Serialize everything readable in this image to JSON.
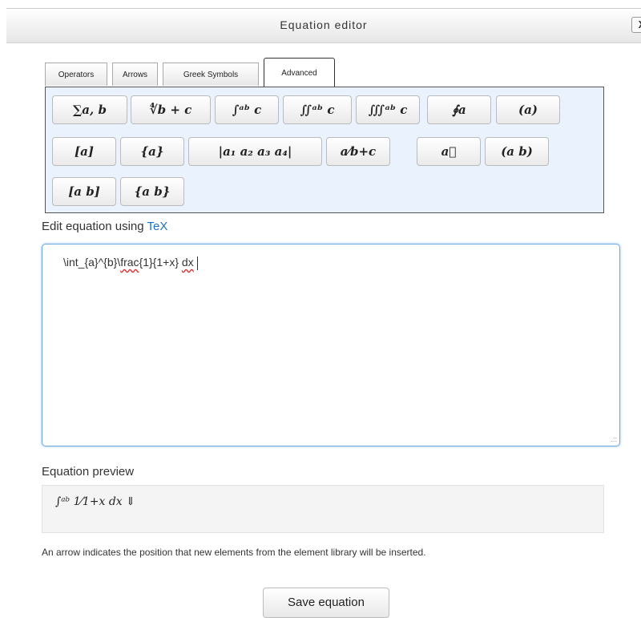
{
  "dialog": {
    "title": "Equation editor",
    "close_label": "X"
  },
  "tabs": [
    {
      "label": "Operators",
      "active": false
    },
    {
      "label": "Arrows",
      "active": false
    },
    {
      "label": "Greek Symbols",
      "active": false
    },
    {
      "label": "Advanced",
      "active": true
    }
  ],
  "library": {
    "buttons": [
      "∑a, b",
      "∜b + c",
      "∫ᵃᵇ c",
      "∬ᵃᵇ c",
      "∭ᵃᵇ c",
      "∮a",
      "(a)",
      "[a]",
      "{a}",
      "|a₁  a₂ a₃  a₄|",
      "a⁄b+c",
      "a⃗",
      "(a b)",
      "[a b]",
      "{a b}"
    ]
  },
  "editor": {
    "label_prefix": "Edit equation using ",
    "label_link": "TeX",
    "value_part1": "\\int_{a}^{b}\\",
    "value_misspelled1": "frac",
    "value_part2": "{1}{1+x} ",
    "value_misspelled2": "dx"
  },
  "preview": {
    "label": "Equation preview",
    "math": "∫ᵃᵇ 1⁄1+x dx ⇓",
    "hint": "An arrow indicates the position that new elements from the element library will be inserted."
  },
  "save_label": "Save equation"
}
